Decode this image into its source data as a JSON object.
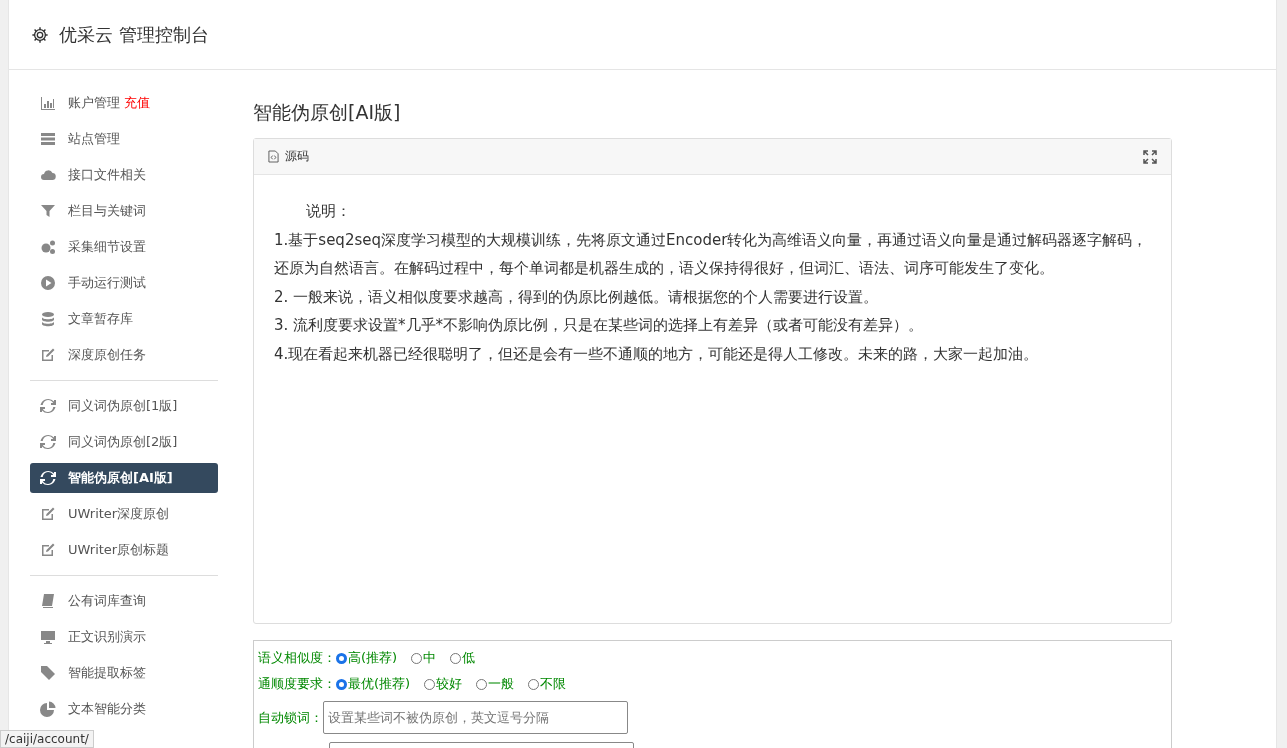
{
  "header": {
    "title": "优采云 管理控制台"
  },
  "sidebar": {
    "groups": [
      {
        "items": [
          {
            "label": "账户管理",
            "badge": "充值",
            "selected": false
          },
          {
            "label": "站点管理",
            "selected": false
          },
          {
            "label": "接口文件相关",
            "selected": false
          },
          {
            "label": "栏目与关键词",
            "selected": false
          },
          {
            "label": "采集细节设置",
            "selected": false
          },
          {
            "label": "手动运行测试",
            "selected": false
          },
          {
            "label": "文章暂存库",
            "selected": false
          },
          {
            "label": "深度原创任务",
            "selected": false
          }
        ]
      },
      {
        "items": [
          {
            "label": "同义词伪原创[1版]",
            "selected": false
          },
          {
            "label": "同义词伪原创[2版]",
            "selected": false
          },
          {
            "label": "智能伪原创[AI版]",
            "selected": true
          },
          {
            "label": "UWriter深度原创",
            "selected": false
          },
          {
            "label": "UWriter原创标题",
            "selected": false
          }
        ]
      },
      {
        "items": [
          {
            "label": "公有词库查询",
            "selected": false
          },
          {
            "label": "正文识别演示",
            "selected": false
          },
          {
            "label": "智能提取标签",
            "selected": false
          },
          {
            "label": "文本智能分类",
            "selected": false
          }
        ]
      }
    ]
  },
  "page_title": "智能伪原创[AI版]",
  "editor": {
    "toolbar_label": "源码",
    "content": [
      "说明：",
      "1.基于seq2seq深度学习模型的大规模训练，先将原文通过Encoder转化为高维语义向量，再通过语义向量是通过解码器逐字解码，还原为自然语言。在解码过程中，每个单词都是机器生成的，语义保持得很好，但词汇、语法、词序可能发生了变化。",
      "2. 一般来说，语义相似度要求越高，得到的伪原比例越低。请根据您的个人需要进行设置。",
      "3. 流利度要求设置*几乎*不影响伪原比例，只是在某些词的选择上有差异（或者可能没有差异）。",
      "4.现在看起来机器已经很聪明了，但还是会有一些不通顺的地方，可能还是得人工修改。未来的路，大家一起加油。"
    ]
  },
  "options": {
    "similarity": {
      "label": "语义相似度：",
      "choices": [
        {
          "label": "高(推荐)",
          "selected": true
        },
        {
          "label": "中",
          "selected": false
        },
        {
          "label": "低",
          "selected": false
        }
      ]
    },
    "fluency": {
      "label": "通顺度要求：",
      "choices": [
        {
          "label": "最优(推荐)",
          "selected": true
        },
        {
          "label": "较好",
          "selected": false
        },
        {
          "label": "一般",
          "selected": false
        },
        {
          "label": "不限",
          "selected": false
        }
      ]
    },
    "lock_words": {
      "label": "自动锁词：",
      "placeholder": "设置某些词不被伪原创，英文逗号分隔"
    }
  },
  "status_bar": {
    "url": "/caiji/account/"
  }
}
